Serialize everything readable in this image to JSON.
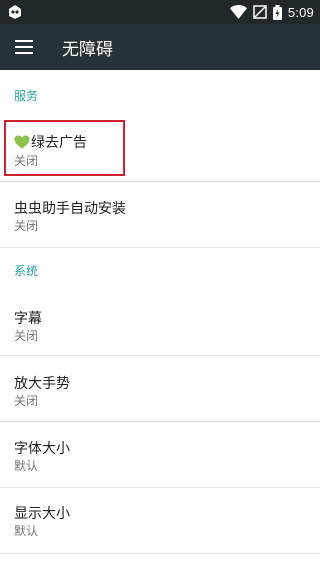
{
  "status_bar": {
    "time": "5:09",
    "icons": [
      "app-notification-icon",
      "wifi-icon",
      "no-sim-icon",
      "battery-icon"
    ]
  },
  "toolbar": {
    "title": "无障碍",
    "menu_icon": "hamburger-menu-icon"
  },
  "sections": [
    {
      "header": "服务",
      "items": [
        {
          "title": "绿去广告",
          "subtitle": "关闭",
          "icon": "green-heart-icon",
          "highlighted": true
        },
        {
          "title": "虫虫助手自动安装",
          "subtitle": "关闭"
        }
      ]
    },
    {
      "header": "系统",
      "items": [
        {
          "title": "字幕",
          "subtitle": "关闭"
        },
        {
          "title": "放大手势",
          "subtitle": "关闭"
        },
        {
          "title": "字体大小",
          "subtitle": "默认"
        },
        {
          "title": "显示大小",
          "subtitle": "默认"
        }
      ]
    }
  ],
  "colors": {
    "status_bar": "#21282c",
    "toolbar": "#273238",
    "section_header": "#26a69a",
    "highlight_border": "#cc2230",
    "heart": "#8bc34a"
  }
}
